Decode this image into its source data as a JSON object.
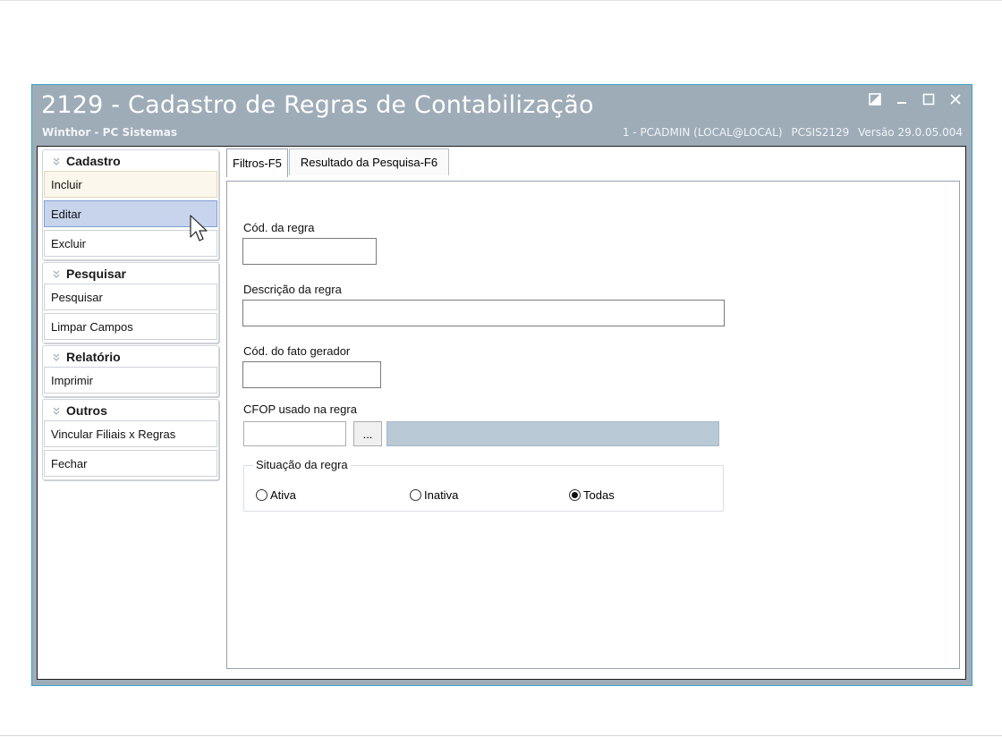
{
  "window": {
    "title": "2129 - Cadastro de Regras de Contabilização",
    "subtitle": "Winthor - PC Sistemas",
    "user": "1 - PCADMIN (LOCAL@LOCAL)",
    "program": "PCSIS2129",
    "version": "Versão  29.0.05.004"
  },
  "sidebar": {
    "groups": [
      {
        "title": "Cadastro",
        "items": [
          "Incluir",
          "Editar",
          "Excluir"
        ]
      },
      {
        "title": "Pesquisar",
        "items": [
          "Pesquisar",
          "Limpar Campos"
        ]
      },
      {
        "title": "Relatório",
        "items": [
          "Imprimir"
        ]
      },
      {
        "title": "Outros",
        "items": [
          "Vincular Filiais x Regras",
          "Fechar"
        ]
      }
    ],
    "hovered": "Incluir",
    "selected": "Editar"
  },
  "tabs": [
    {
      "label": "Filtros-F5",
      "active": true
    },
    {
      "label": "Resultado da Pesquisa-F6",
      "active": false
    }
  ],
  "form": {
    "cod_regra": {
      "label": "Cód. da regra",
      "value": ""
    },
    "descricao_regra": {
      "label": "Descrição da regra",
      "value": ""
    },
    "cod_fato_gerador": {
      "label": "Cód. do fato gerador",
      "value": ""
    },
    "cfop": {
      "label": "CFOP usado na regra",
      "value": "",
      "button": "...",
      "description": ""
    },
    "situacao": {
      "legend": "Situação da regra",
      "options": [
        "Ativa",
        "Inativa",
        "Todas"
      ],
      "selected": "Todas"
    }
  },
  "colors": {
    "titlebar": "#9eacb8",
    "window_border": "#39a2c9",
    "selected_item": "#c7d4ec",
    "hover_item": "#fbf7ec",
    "readonly_field": "#b9c9d6"
  }
}
